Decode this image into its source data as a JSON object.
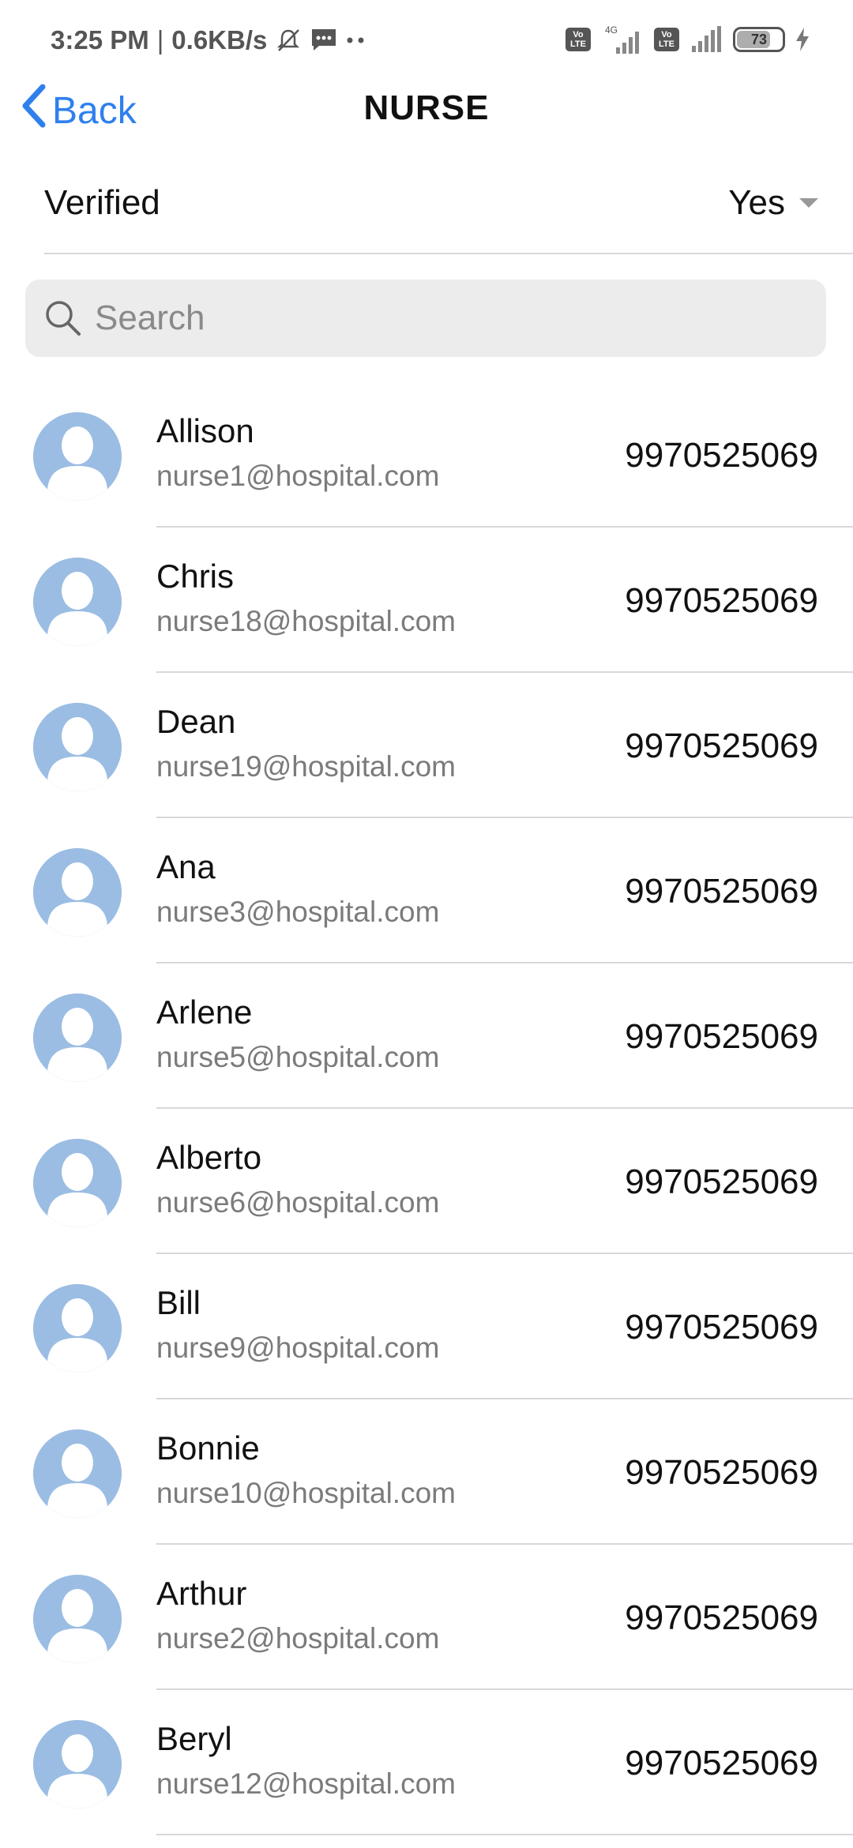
{
  "status_bar": {
    "time": "3:25 PM",
    "speed": "0.6KB/s",
    "network": "4G",
    "volte": "Vo LTE",
    "battery": "73"
  },
  "nav": {
    "back_label": "Back",
    "title": "NURSE"
  },
  "filter": {
    "label": "Verified",
    "value": "Yes"
  },
  "search": {
    "placeholder": "Search"
  },
  "nurses": [
    {
      "name": "Allison",
      "email": "nurse1@hospital.com",
      "phone": "9970525069"
    },
    {
      "name": "Chris",
      "email": "nurse18@hospital.com",
      "phone": "9970525069"
    },
    {
      "name": "Dean",
      "email": "nurse19@hospital.com",
      "phone": "9970525069"
    },
    {
      "name": "Ana",
      "email": "nurse3@hospital.com",
      "phone": "9970525069"
    },
    {
      "name": "Arlene",
      "email": "nurse5@hospital.com",
      "phone": "9970525069"
    },
    {
      "name": "Alberto",
      "email": "nurse6@hospital.com",
      "phone": "9970525069"
    },
    {
      "name": "Bill",
      "email": "nurse9@hospital.com",
      "phone": "9970525069"
    },
    {
      "name": "Bonnie",
      "email": "nurse10@hospital.com",
      "phone": "9970525069"
    },
    {
      "name": "Arthur",
      "email": "nurse2@hospital.com",
      "phone": "9970525069"
    },
    {
      "name": "Beryl",
      "email": "nurse12@hospital.com",
      "phone": "9970525069"
    }
  ],
  "colors": {
    "accent": "#2f80ed",
    "avatar": "#9bbde3",
    "search_bg": "#ececec"
  }
}
